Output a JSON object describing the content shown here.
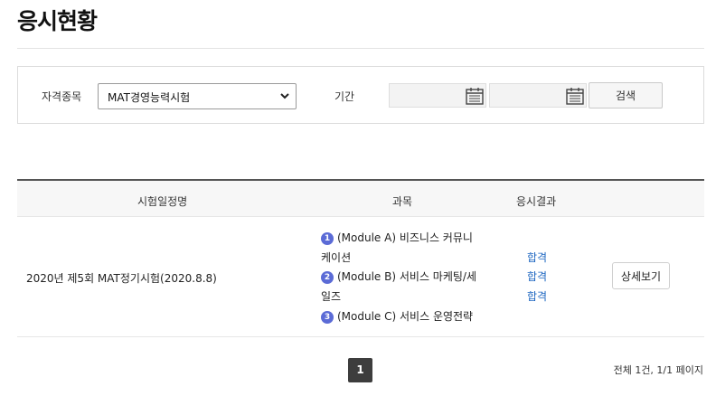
{
  "page": {
    "title": "응시현황"
  },
  "filter": {
    "category_label": "자격종목",
    "category_value": "MAT경영능력시험",
    "period_label": "기간",
    "date_from": "",
    "date_to": "",
    "search_label": "검색"
  },
  "table": {
    "headers": [
      "시험일정명",
      "과목",
      "응시결과"
    ],
    "rows": [
      {
        "exam_name": "2020년 제5회 MAT정기시험(2020.8.8)",
        "subjects": [
          {
            "num": "1",
            "line1": "(Module A) 비즈니스 커뮤니",
            "line2": "케이션"
          },
          {
            "num": "2",
            "line1": "(Module B) 서비스 마케팅/세",
            "line2": "일즈"
          },
          {
            "num": "3",
            "line1": "(Module C) 서비스 운영전략",
            "line2": ""
          }
        ],
        "results": [
          "합격",
          "합격",
          "합격"
        ],
        "detail_label": "상세보기"
      }
    ]
  },
  "pagination": {
    "current": "1",
    "total_text": "전체 1건, 1/1 페이지"
  },
  "colors": {
    "accent": "#5b6bd6",
    "link": "#1a64c0",
    "page_active": "#3d3d3d"
  }
}
